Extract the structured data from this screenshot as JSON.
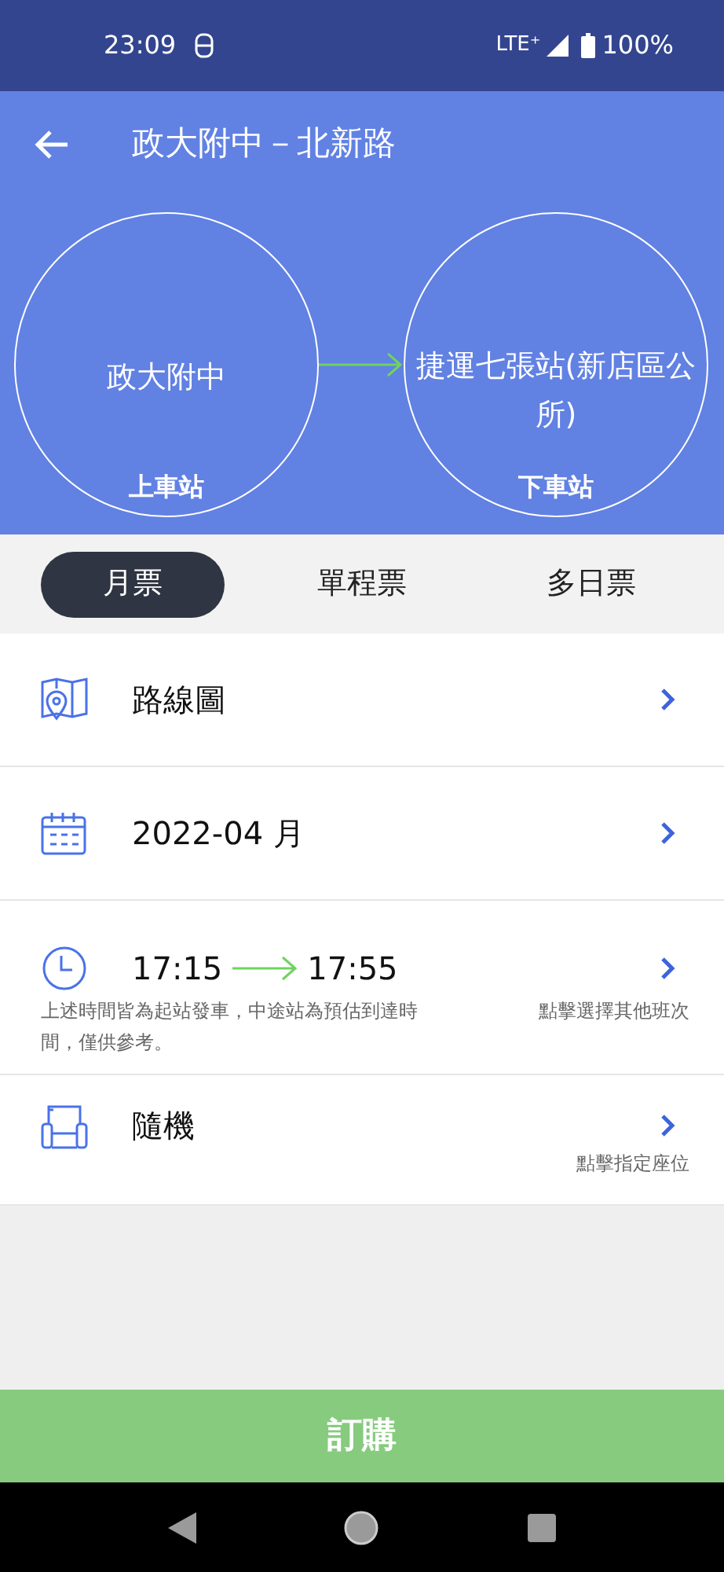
{
  "status_bar": {
    "time": "23:09",
    "network": "LTE⁺",
    "battery": "100%"
  },
  "header": {
    "title": "政大附中－北新路"
  },
  "route": {
    "from": {
      "name": "政大附中",
      "label": "上車站"
    },
    "to": {
      "name": "捷運七張站(新店區公所)",
      "label": "下車站"
    }
  },
  "tabs": [
    {
      "label": "月票",
      "selected": true
    },
    {
      "label": "單程票",
      "selected": false
    },
    {
      "label": "多日票",
      "selected": false
    }
  ],
  "rows": [
    {
      "kind": "map",
      "title": "路線圖"
    },
    {
      "kind": "calendar",
      "title": "2022-04 月"
    },
    {
      "kind": "time",
      "depart": "17:15",
      "arrive": "17:55",
      "note": "上述時間皆為起站發車，中途站為預估到達時間，僅供參考。",
      "hint": "點擊選擇其他班次"
    },
    {
      "kind": "seat",
      "title": "隨機",
      "hint": "點擊指定座位"
    }
  ],
  "order_button": "訂購"
}
